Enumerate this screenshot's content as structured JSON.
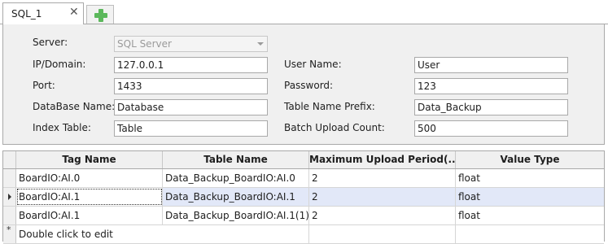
{
  "tabs": [
    {
      "label": "SQL_1",
      "close_glyph": "✕",
      "icon": "close-icon"
    }
  ],
  "add_tab_icon": "plus-icon",
  "form": {
    "server_label": "Server:",
    "server_value": "SQL Server",
    "ip_label": "IP/Domain:",
    "ip_value": "127.0.0.1",
    "port_label": "Port:",
    "port_value": "1433",
    "database_label": "DataBase Name:",
    "database_value": "Database",
    "index_table_label": "Index Table:",
    "index_table_value": "Table",
    "user_label": "User Name:",
    "user_value": "User",
    "password_label": "Password:",
    "password_value": "123",
    "prefix_label": "Table Name Prefix:",
    "prefix_value": "Data_Backup",
    "batch_label": "Batch Upload Count:",
    "batch_value": "500"
  },
  "grid": {
    "columns": [
      "Tag Name",
      "Table Name",
      "Maximum Upload Period(...",
      "Value Type"
    ],
    "rows": [
      [
        "BoardIO:AI.0",
        "Data_Backup_BoardIO:AI.0",
        "2",
        "float"
      ],
      [
        "BoardIO:AI.1",
        "Data_Backup_BoardIO:AI.1",
        "2",
        "float"
      ],
      [
        "BoardIO:AI.1",
        "Data_Backup_BoardIO:AI.1(1)",
        "2",
        "float"
      ]
    ],
    "selected_row": 1,
    "new_row_marker": "*",
    "new_row_text": "Double click to edit"
  },
  "colors": {
    "panel_bg": "#f0f0f0",
    "selected_row_bg": "#e2e8f8",
    "add_icon": "#5cb85c"
  }
}
